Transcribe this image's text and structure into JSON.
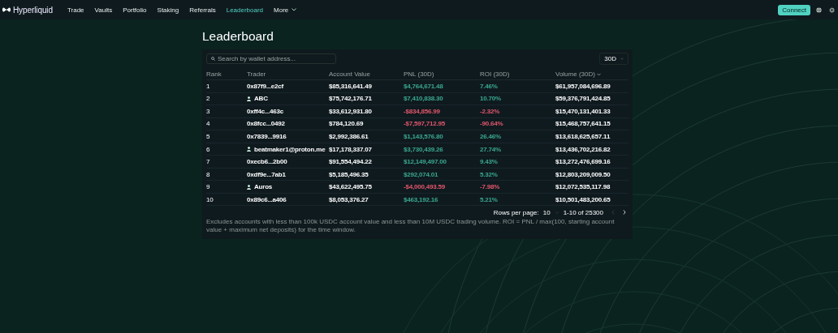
{
  "nav": {
    "brand": "Hyperliquid",
    "items": [
      {
        "label": "Trade",
        "selected": false
      },
      {
        "label": "Vaults",
        "selected": false
      },
      {
        "label": "Portfolio",
        "selected": false
      },
      {
        "label": "Staking",
        "selected": false
      },
      {
        "label": "Referrals",
        "selected": false
      },
      {
        "label": "Leaderboard",
        "selected": true
      }
    ],
    "more": "More",
    "connect": "Connect"
  },
  "title": "Leaderboard",
  "search": {
    "placeholder": "Search by wallet address..."
  },
  "period": "30D",
  "table": {
    "columns": [
      "Rank",
      "Trader",
      "Account Value",
      "PNL (30D)",
      "ROI (30D)",
      "Volume (30D)"
    ],
    "rows": [
      {
        "rank": "1",
        "kind": "address",
        "trader": "0x87f9...e2cf",
        "account_value": "$85,316,641.49",
        "pnl": "$4,764,671.48",
        "roi": "7.46%",
        "color": "#3aa88f",
        "volume": "$61,957,084,696.89"
      },
      {
        "rank": "2",
        "kind": "named",
        "trader": "ABC",
        "account_value": "$75,742,176.71",
        "pnl": "$7,410,838.30",
        "roi": "10.70%",
        "color": "#3aa88f",
        "volume": "$59,376,791,424.85"
      },
      {
        "rank": "3",
        "kind": "address",
        "trader": "0xff4c...463c",
        "account_value": "$33,612,931.80",
        "pnl": "-$834,856.99",
        "roi": "-2.32%",
        "color": "#e2566b",
        "volume": "$15,470,131,401.33"
      },
      {
        "rank": "4",
        "kind": "address",
        "trader": "0x8fcc...0492",
        "account_value": "$784,120.69",
        "pnl": "-$7,597,712.95",
        "roi": "-90.64%",
        "color": "#e2566b",
        "volume": "$15,468,757,641.15"
      },
      {
        "rank": "5",
        "kind": "address",
        "trader": "0x7839...9916",
        "account_value": "$2,992,386.61",
        "pnl": "$1,143,576.80",
        "roi": "26.46%",
        "color": "#3aa88f",
        "volume": "$13,618,625,657.11"
      },
      {
        "rank": "6",
        "kind": "named",
        "trader": "beatmaker1@proton.me",
        "account_value": "$17,178,337.07",
        "pnl": "$3,730,439.26",
        "roi": "27.74%",
        "color": "#3aa88f",
        "volume": "$13,436,702,216.82"
      },
      {
        "rank": "7",
        "kind": "address",
        "trader": "0xecb6...2b00",
        "account_value": "$91,554,494.22",
        "pnl": "$12,149,497.00",
        "roi": "9.43%",
        "color": "#3aa88f",
        "volume": "$13,272,476,699.16"
      },
      {
        "rank": "8",
        "kind": "address",
        "trader": "0xdf9e...7ab1",
        "account_value": "$5,185,496.35",
        "pnl": "$292,074.01",
        "roi": "5.32%",
        "color": "#3aa88f",
        "volume": "$12,803,209,009.50"
      },
      {
        "rank": "9",
        "kind": "named",
        "trader": "Auros",
        "account_value": "$43,622,495.75",
        "pnl": "-$4,000,493.59",
        "roi": "-7.98%",
        "color": "#e2566b",
        "volume": "$12,072,535,117.98"
      },
      {
        "rank": "10",
        "kind": "address",
        "trader": "0x89c6...a406",
        "account_value": "$8,053,376.27",
        "pnl": "$463,192.16",
        "roi": "5.21%",
        "color": "#3aa88f",
        "volume": "$10,501,483,200.65"
      }
    ]
  },
  "pagination": {
    "rows_per_page_label": "Rows per page:",
    "rows_per_page": "10",
    "range": "1-10 of 25300"
  },
  "footnote": "Excludes accounts with less than 100k USDC account value and less than 10M USDC trading volume. ROI = PNL / max(100, starting account value + maximum net deposits) for the time window."
}
